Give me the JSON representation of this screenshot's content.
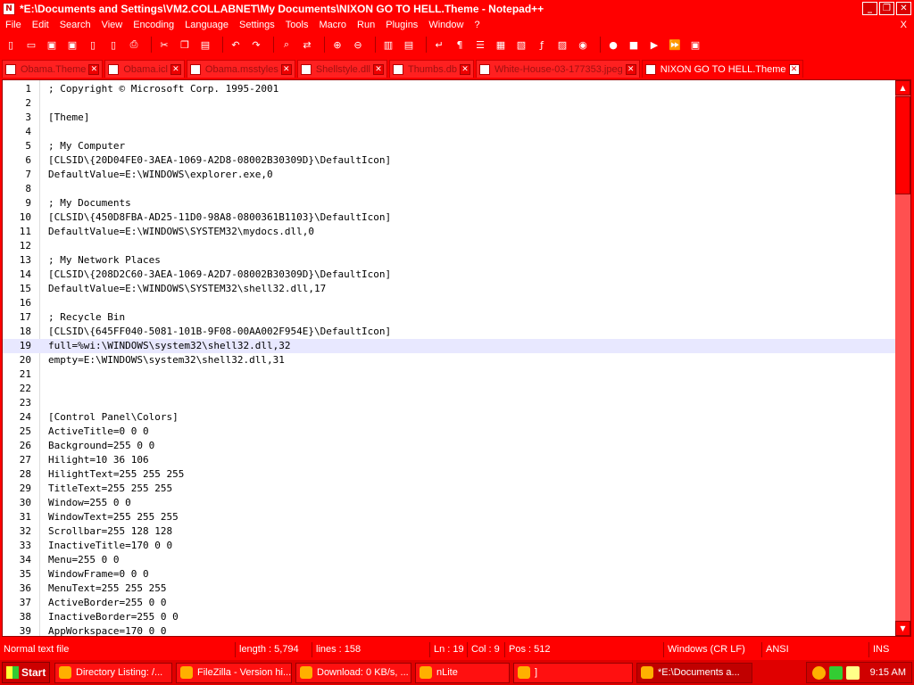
{
  "window": {
    "title": "*E:\\Documents and Settings\\VM2.COLLABNET\\My Documents\\NIXON GO TO HELL.Theme - Notepad++",
    "icon": "notepad-plus-icon",
    "buttons": {
      "minimize": "_",
      "maximize": "❐",
      "close": "✕"
    }
  },
  "menu": [
    "File",
    "Edit",
    "Search",
    "View",
    "Encoding",
    "Language",
    "Settings",
    "Tools",
    "Macro",
    "Run",
    "Plugins",
    "Window",
    "?"
  ],
  "menu_close": "X",
  "toolbar": [
    {
      "name": "new-file-icon",
      "glyph": "▯"
    },
    {
      "name": "open-file-icon",
      "glyph": "▭"
    },
    {
      "name": "save-icon",
      "glyph": "▣"
    },
    {
      "name": "save-all-icon",
      "glyph": "▣"
    },
    {
      "name": "close-file-icon",
      "glyph": "▯"
    },
    {
      "name": "close-all-icon",
      "glyph": "▯"
    },
    {
      "name": "print-icon",
      "glyph": "⎙"
    },
    {
      "sep": true
    },
    {
      "name": "cut-icon",
      "glyph": "✂"
    },
    {
      "name": "copy-icon",
      "glyph": "❐"
    },
    {
      "name": "paste-icon",
      "glyph": "▤"
    },
    {
      "sep": true
    },
    {
      "name": "undo-icon",
      "glyph": "↶"
    },
    {
      "name": "redo-icon",
      "glyph": "↷"
    },
    {
      "sep": true
    },
    {
      "name": "find-icon",
      "glyph": "⌕"
    },
    {
      "name": "replace-icon",
      "glyph": "⇄"
    },
    {
      "sep": true
    },
    {
      "name": "zoom-in-icon",
      "glyph": "⊕"
    },
    {
      "name": "zoom-out-icon",
      "glyph": "⊖"
    },
    {
      "sep": true
    },
    {
      "name": "sync-vertical-icon",
      "glyph": "▥"
    },
    {
      "name": "sync-horizontal-icon",
      "glyph": "▤"
    },
    {
      "sep": true
    },
    {
      "name": "word-wrap-icon",
      "glyph": "↵"
    },
    {
      "name": "show-all-chars-icon",
      "glyph": "¶"
    },
    {
      "name": "indent-guide-icon",
      "glyph": "☰"
    },
    {
      "name": "user-language-icon",
      "glyph": "▦"
    },
    {
      "name": "doc-map-icon",
      "glyph": "▧"
    },
    {
      "name": "function-list-icon",
      "glyph": "ƒ"
    },
    {
      "name": "folder-workspace-icon",
      "glyph": "▨"
    },
    {
      "name": "monitoring-icon",
      "glyph": "◉"
    },
    {
      "sep": true
    },
    {
      "name": "macro-record-icon",
      "glyph": "●"
    },
    {
      "name": "macro-stop-icon",
      "glyph": "■"
    },
    {
      "name": "macro-play-icon",
      "glyph": "▶"
    },
    {
      "name": "macro-play-multiple-icon",
      "glyph": "⏩"
    },
    {
      "name": "macro-save-icon",
      "glyph": "▣"
    }
  ],
  "tabs": [
    {
      "label": "Obama.Theme",
      "active": false
    },
    {
      "label": "Obama.icl",
      "active": false
    },
    {
      "label": "Obama.msstyles",
      "active": false
    },
    {
      "label": "Shellstyle.dll",
      "active": false
    },
    {
      "label": "Thumbs.db",
      "active": false
    },
    {
      "label": "White-House-03-177353.jpeg",
      "active": false
    },
    {
      "label": "NIXON GO TO HELL.Theme",
      "active": true
    }
  ],
  "editor": {
    "current_line": 19,
    "lines": [
      {
        "n": "1",
        "t": "; Copyright © Microsoft Corp. 1995-2001"
      },
      {
        "n": "2",
        "t": ""
      },
      {
        "n": "3",
        "t": "[Theme]"
      },
      {
        "n": "4",
        "t": ""
      },
      {
        "n": "5",
        "t": "; My Computer"
      },
      {
        "n": "6",
        "t": "[CLSID\\{20D04FE0-3AEA-1069-A2D8-08002B30309D}\\DefaultIcon]"
      },
      {
        "n": "7",
        "t": "DefaultValue=E:\\WINDOWS\\explorer.exe,0"
      },
      {
        "n": "8",
        "t": ""
      },
      {
        "n": "9",
        "t": "; My Documents"
      },
      {
        "n": "10",
        "t": "[CLSID\\{450D8FBA-AD25-11D0-98A8-0800361B1103}\\DefaultIcon]"
      },
      {
        "n": "11",
        "t": "DefaultValue=E:\\WINDOWS\\SYSTEM32\\mydocs.dll,0"
      },
      {
        "n": "12",
        "t": ""
      },
      {
        "n": "13",
        "t": "; My Network Places"
      },
      {
        "n": "14",
        "t": "[CLSID\\{208D2C60-3AEA-1069-A2D7-08002B30309D}\\DefaultIcon]"
      },
      {
        "n": "15",
        "t": "DefaultValue=E:\\WINDOWS\\SYSTEM32\\shell32.dll,17"
      },
      {
        "n": "16",
        "t": ""
      },
      {
        "n": "17",
        "t": "; Recycle Bin"
      },
      {
        "n": "18",
        "t": "[CLSID\\{645FF040-5081-101B-9F08-00AA002F954E}\\DefaultIcon]"
      },
      {
        "n": "19",
        "t": "full=%wi:\\WINDOWS\\system32\\shell32.dll,32"
      },
      {
        "n": "20",
        "t": "empty=E:\\WINDOWS\\system32\\shell32.dll,31"
      },
      {
        "n": "21",
        "t": ""
      },
      {
        "n": "22",
        "t": ""
      },
      {
        "n": "23",
        "t": ""
      },
      {
        "n": "24",
        "t": "[Control Panel\\Colors]"
      },
      {
        "n": "25",
        "t": "ActiveTitle=0 0 0"
      },
      {
        "n": "26",
        "t": "Background=255 0 0"
      },
      {
        "n": "27",
        "t": "Hilight=10 36 106"
      },
      {
        "n": "28",
        "t": "HilightText=255 255 255"
      },
      {
        "n": "29",
        "t": "TitleText=255 255 255"
      },
      {
        "n": "30",
        "t": "Window=255 0 0"
      },
      {
        "n": "31",
        "t": "WindowText=255 255 255"
      },
      {
        "n": "32",
        "t": "Scrollbar=255 128 128"
      },
      {
        "n": "33",
        "t": "InactiveTitle=170 0 0"
      },
      {
        "n": "34",
        "t": "Menu=255 0 0"
      },
      {
        "n": "35",
        "t": "WindowFrame=0 0 0"
      },
      {
        "n": "36",
        "t": "MenuText=255 255 255"
      },
      {
        "n": "37",
        "t": "ActiveBorder=255 0 0"
      },
      {
        "n": "38",
        "t": "InactiveBorder=255 0 0"
      },
      {
        "n": "39",
        "t": "AppWorkspace=170 0 0"
      }
    ]
  },
  "status": {
    "type": "Normal text file",
    "length": "length : 5,794",
    "lines": "lines : 158",
    "ln": "Ln : 19",
    "col": "Col : 9",
    "pos": "Pos : 512",
    "eol": "Windows (CR LF)",
    "encoding": "ANSI",
    "mode": "INS"
  },
  "taskbar": {
    "start_label": "Start",
    "items": [
      {
        "label": "Directory Listing: /...",
        "active": false
      },
      {
        "label": "FileZilla - Version hi...",
        "active": false
      },
      {
        "label": "Download: 0 KB/s, ...",
        "active": false
      },
      {
        "label": "nLite",
        "active": false
      },
      {
        "label": "]",
        "active": false
      },
      {
        "label": "*E:\\Documents a...",
        "active": true
      }
    ],
    "clock": "9:15 AM"
  },
  "colors": {
    "chrome": "#ff0000",
    "editor_bg": "#ffffff",
    "current_line": "#e8e8ff"
  }
}
